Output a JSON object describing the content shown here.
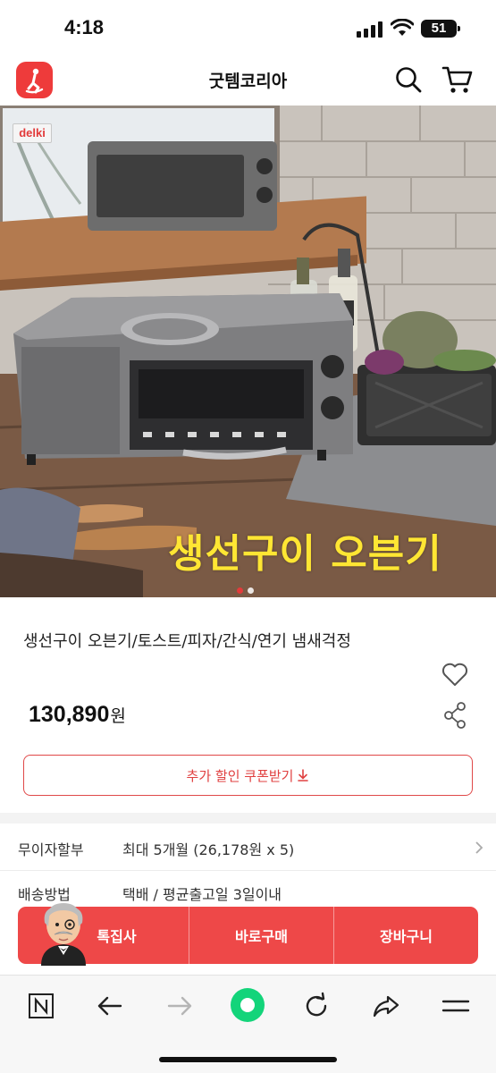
{
  "status_bar": {
    "time": "4:18",
    "battery": "51"
  },
  "header": {
    "title": "굿템코리아",
    "logo_icon": "person-icon"
  },
  "product_image": {
    "brand": "delki",
    "caption": "생선구이 오븐기",
    "slides_total": 2,
    "slide_active": 1
  },
  "product": {
    "name": "생선구이 오븐기/토스트/피자/간식/연기 냄새걱정",
    "price": "130,890",
    "price_unit": "원"
  },
  "coupon": {
    "label": "추가 할인 쿠폰받기"
  },
  "info_rows": [
    {
      "label": "무이자할부",
      "value": "최대 5개월 (26,178원 x 5)"
    },
    {
      "label": "배송방법",
      "value": "택배 / 평균출고일 3일이내"
    }
  ],
  "actions": {
    "special": "톡집사",
    "buy_now": "바로구매",
    "cart": "장바구니"
  },
  "colors": {
    "accent": "#ee4848",
    "caption": "#ffe633",
    "logo": "#ee3b3b"
  }
}
